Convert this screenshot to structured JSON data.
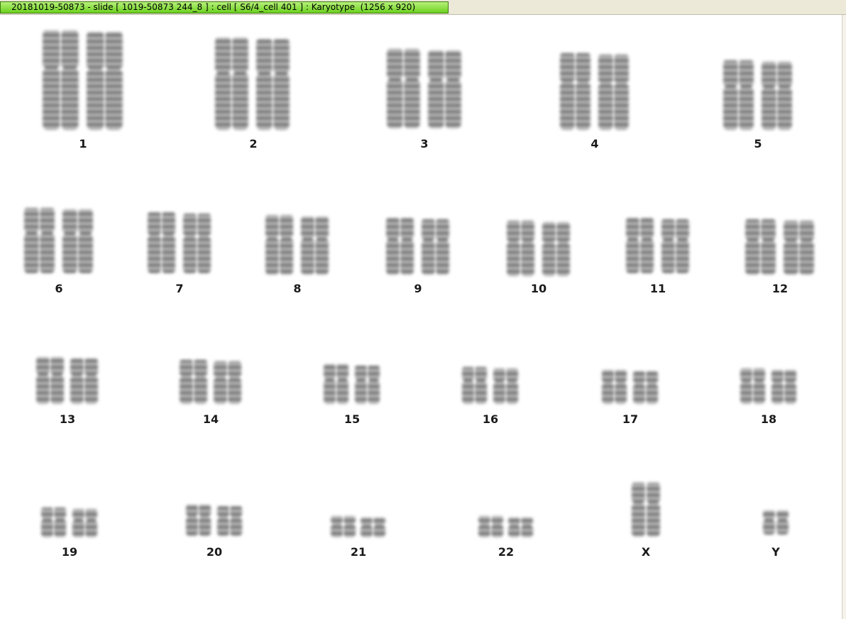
{
  "window": {
    "title": "20181019-50873 - slide [ 1019-50873 244_8 ] : cell [ S6/4_cell 401 ] : Karyotype  (1256 x 920)"
  },
  "karyotype": {
    "labels": [
      "1",
      "2",
      "3",
      "4",
      "5",
      "6",
      "7",
      "8",
      "9",
      "10",
      "11",
      "12",
      "13",
      "14",
      "15",
      "16",
      "17",
      "18",
      "19",
      "20",
      "21",
      "22",
      "X",
      "Y"
    ]
  }
}
